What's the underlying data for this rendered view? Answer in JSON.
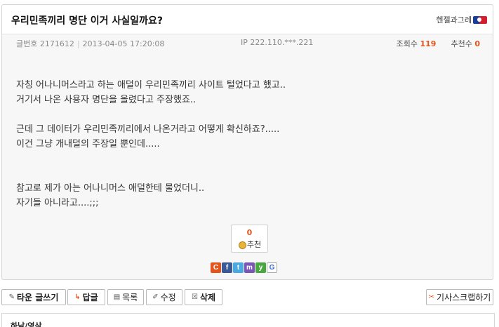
{
  "post": {
    "title": "우리민족끼리 명단 이거 사실일까요?",
    "author": "헨젤과그레",
    "author_badge_icon": "mlb-logo-icon",
    "post_no_label": "글번호",
    "post_no": "2171612",
    "datetime": "2013-04-05 17:20:08",
    "ip_label": "IP",
    "ip": "222.110.***.221",
    "views_label": "조회수",
    "views": "119",
    "recommends_label": "추천수",
    "recommends": "0",
    "body": [
      "자칭 어나니머스라고 하는 애덜이 우리민족끼리 사이트 털었다고 했고..",
      "거기서 나온 사용자 명단을 올렸다고 주장했죠..",
      "근데 그 데이터가 우리민족끼리에서 나온거라고 어떻게 확신하죠?.....",
      "이건 그냥 개내덜의 주장일 뿐인데.....",
      "참고로 제가 아는 어나니머스 애덜한테 물었더니..",
      "자기들 아니라고....;;;"
    ]
  },
  "recommend_box": {
    "count": "0",
    "label": "추천",
    "icon": "medal-icon"
  },
  "share": [
    {
      "name": "c-share-icon",
      "glyph": "C",
      "color": "#e2561d"
    },
    {
      "name": "facebook-icon",
      "glyph": "f",
      "color": "#3b5998"
    },
    {
      "name": "twitter-icon",
      "glyph": "t",
      "color": "#4aa9e0"
    },
    {
      "name": "me2day-icon",
      "glyph": "m",
      "color": "#7a55b8"
    },
    {
      "name": "yozm-icon",
      "glyph": "y",
      "color": "#4aa640"
    },
    {
      "name": "google-icon",
      "glyph": "G",
      "color": "#ffffff"
    }
  ],
  "buttons": {
    "write": "타운 글쓰기",
    "reply": "답글",
    "list": "목록",
    "edit": "수정",
    "delete": "삭제",
    "scrap": "기사스크랩하기"
  },
  "bottom": {
    "text": "하남/영삼"
  },
  "colors": {
    "accent": "#e2561d",
    "border": "#d6d6d6"
  }
}
